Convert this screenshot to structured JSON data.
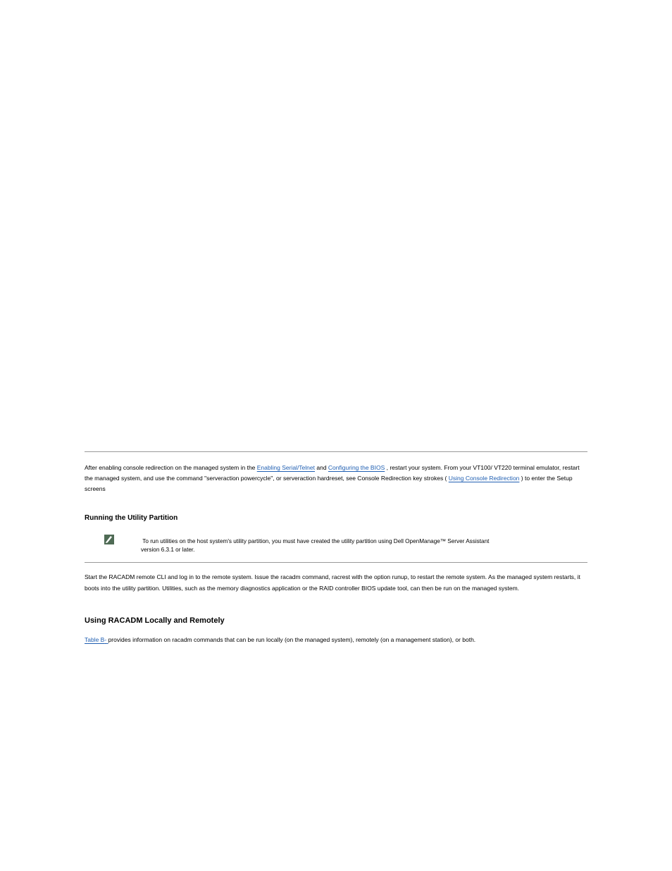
{
  "p1_pre": "After enabling console redirection on the managed system in the ",
  "p1_link1": "Enabling Serial/Telnet",
  "p1_mid1": " and ",
  "p1_link2": "Configuring the BIOS",
  "p1_mid2": ", restart your system. From your VT100/ VT220 terminal emulator, restart the managed system, and use the command \"serveraction powercycle\", or serveraction hardreset, see Console Redirection key strokes (",
  "p1_link3": "Using Console Redirection",
  "p1_mid3": ") to enter the Setup screens",
  "heading_utility": "Running the Utility Partition",
  "note_text_a": " To run utilities on the host system's utility partition, you must have created the utility partition using Dell OpenManage™ Server Assistant",
  "note_text_b": "version 6.3.1 or later.",
  "p2_text": "Start the RACADM remote CLI and log in to the remote system. Issue the racadm command, racrest with the option runup, to restart the remote system. As the managed system restarts, it boots into the utility partition. Utilities, such as the memory diagnostics application or the RAID controller BIOS update tool, can then be run on the managed system.",
  "heading_main": "Using RACADM Locally and Remotely",
  "p3_pre": "",
  "p3_link": "Table B",
  "p3_reg": "-",
  "p3_post": " provides information on racadm commands that can be run locally (on the managed system), remotely (on a management station), or both."
}
